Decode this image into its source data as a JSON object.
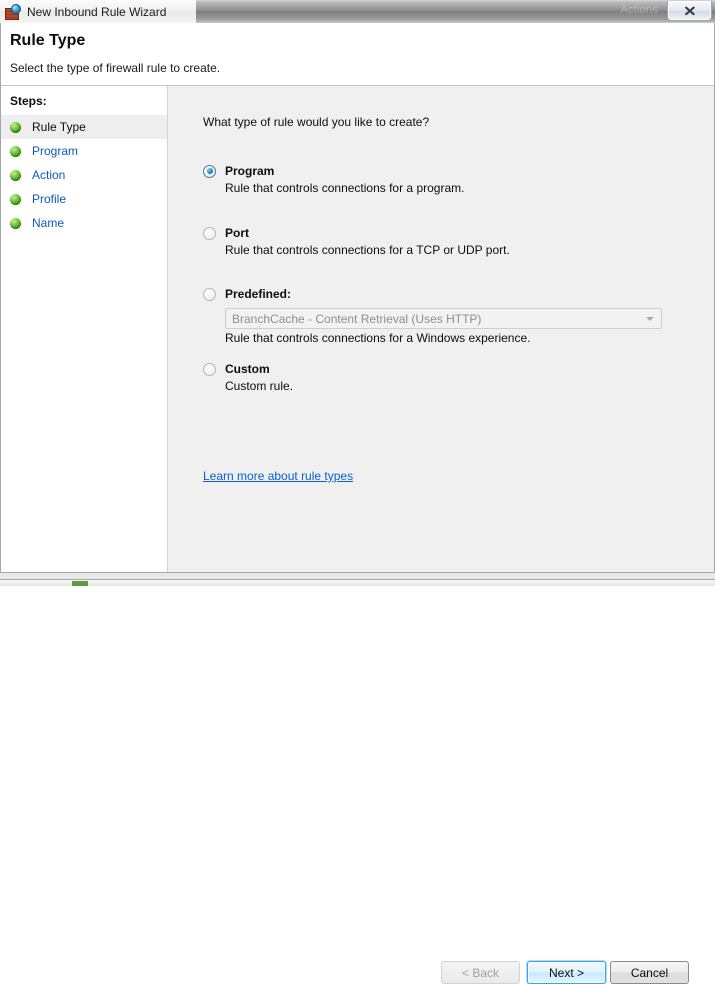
{
  "window": {
    "title": "New Inbound Rule Wizard",
    "app_icon": "firewall-brickwall-globe-icon",
    "close_label": "✕",
    "ghost_title": "Actions"
  },
  "header": {
    "title": "Rule Type",
    "subtitle": "Select the type of firewall rule to create."
  },
  "sidebar": {
    "label": "Steps:",
    "items": [
      {
        "label": "Rule Type",
        "current": true
      },
      {
        "label": "Program",
        "current": false
      },
      {
        "label": "Action",
        "current": false
      },
      {
        "label": "Profile",
        "current": false
      },
      {
        "label": "Name",
        "current": false
      }
    ]
  },
  "content": {
    "question": "What type of rule would you like to create?",
    "options": [
      {
        "title": "Program",
        "description": "Rule that controls connections for a program.",
        "selected": true
      },
      {
        "title": "Port",
        "description": "Rule that controls connections for a TCP or UDP port.",
        "selected": false
      },
      {
        "title": "Predefined:",
        "description": "Rule that controls connections for a Windows experience.",
        "selected": false,
        "combo_value": "BranchCache - Content Retrieval (Uses HTTP)",
        "combo_enabled": false
      },
      {
        "title": "Custom",
        "description": "Custom rule.",
        "selected": false
      }
    ],
    "learn_more": "Learn more about rule types"
  },
  "footer": {
    "back_label": "< Back",
    "next_label": "Next >",
    "cancel_label": "Cancel"
  },
  "colors": {
    "link": "#0a5fd4",
    "step_link": "#0a59c4",
    "radio_accent": "#1f86c8",
    "default_button_border": "#3ba6e0",
    "content_background": "#f0f0f0"
  }
}
